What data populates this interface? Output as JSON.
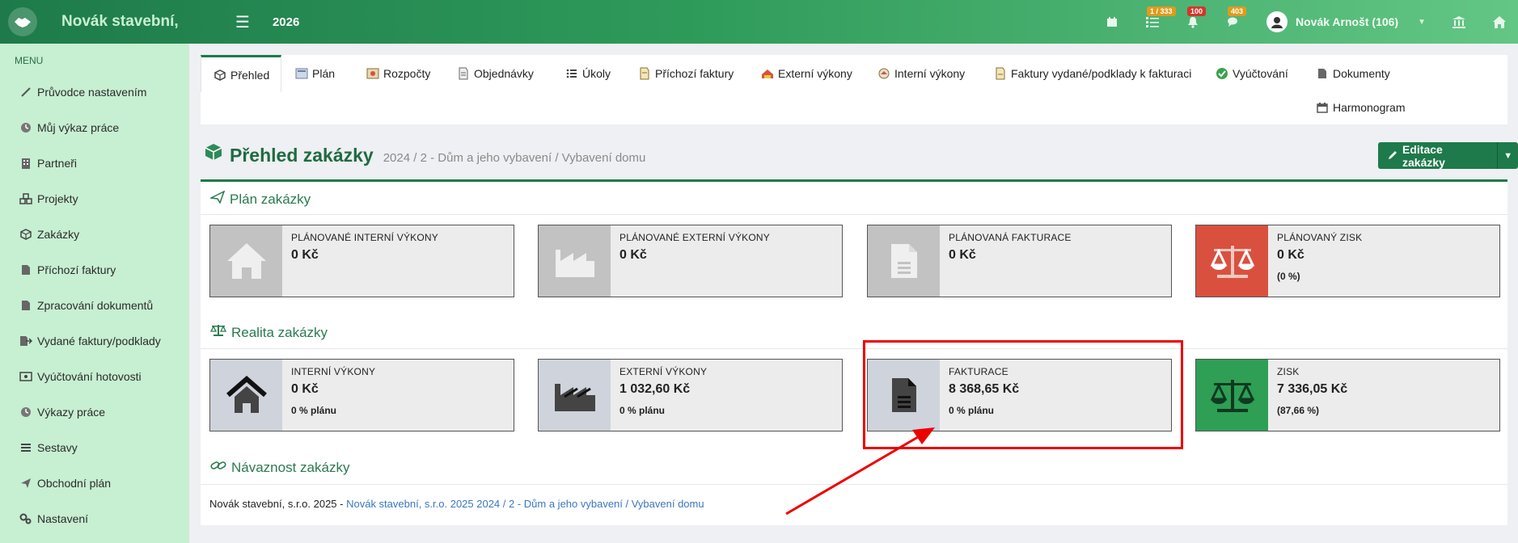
{
  "topbar": {
    "brand": "Novák stavební,",
    "year": "2026",
    "badges": {
      "tasks": "1 / 333",
      "notifications": "100",
      "messages": "403"
    },
    "user": "Novák Arnošt (106)"
  },
  "sidebar": {
    "heading": "MENU",
    "items": [
      {
        "label": "Průvodce nastavením",
        "icon": "wand-icon"
      },
      {
        "label": "Můj výkaz práce",
        "icon": "clock-icon"
      },
      {
        "label": "Partneři",
        "icon": "building-icon"
      },
      {
        "label": "Projekty",
        "icon": "cubes-icon"
      },
      {
        "label": "Zakázky",
        "icon": "cube-icon"
      },
      {
        "label": "Příchozí faktury",
        "icon": "document-icon"
      },
      {
        "label": "Zpracování dokumentů",
        "icon": "document-icon"
      },
      {
        "label": "Vydané faktury/podklady",
        "icon": "export-icon"
      },
      {
        "label": "Vyúčtování hotovosti",
        "icon": "money-icon"
      },
      {
        "label": "Výkazy práce",
        "icon": "clock-icon"
      },
      {
        "label": "Sestavy",
        "icon": "list-icon"
      },
      {
        "label": "Obchodní plán",
        "icon": "paper-plane-icon"
      },
      {
        "label": "Nastavení",
        "icon": "gears-icon"
      }
    ]
  },
  "tabs": [
    {
      "label": "Přehled"
    },
    {
      "label": "Plán"
    },
    {
      "label": "Rozpočty"
    },
    {
      "label": "Objednávky"
    },
    {
      "label": "Úkoly"
    },
    {
      "label": "Příchozí faktury"
    },
    {
      "label": "Externí výkony"
    },
    {
      "label": "Interní výkony"
    },
    {
      "label": "Faktury vydané/podklady k fakturaci"
    },
    {
      "label": "Vyúčtování"
    },
    {
      "label": "Dokumenty"
    },
    {
      "label": "Harmonogram"
    }
  ],
  "header": {
    "title": "Přehled zakázky",
    "subtitle": "2024 / 2 - Dům a jeho vybavení / Vybavení domu",
    "edit_label": "Editace zakázky"
  },
  "plan": {
    "heading": "Plán zakázky",
    "boxes": [
      {
        "label": "PLÁNOVANÉ INTERNÍ VÝKONY",
        "value": "0 Kč",
        "sub": ""
      },
      {
        "label": "PLÁNOVANÉ EXTERNÍ VÝKONY",
        "value": "0 Kč",
        "sub": ""
      },
      {
        "label": "PLÁNOVANÁ FAKTURACE",
        "value": "0 Kč",
        "sub": ""
      },
      {
        "label": "PLÁNOVANÝ ZISK",
        "value": "0 Kč",
        "sub": "(0 %)"
      }
    ]
  },
  "reality": {
    "heading": "Realita zakázky",
    "boxes": [
      {
        "label": "INTERNÍ VÝKONY",
        "value": "0 Kč",
        "sub": "0 % plánu"
      },
      {
        "label": "EXTERNÍ VÝKONY",
        "value": "1 032,60 Kč",
        "sub": "0 % plánu"
      },
      {
        "label": "FAKTURACE",
        "value": "8 368,65 Kč",
        "sub": "0 % plánu"
      },
      {
        "label": "ZISK",
        "value": "7 336,05 Kč",
        "sub": "(87,66 %)"
      }
    ]
  },
  "navaznost": {
    "heading": "Návaznost zakázky",
    "prefix": "Novák stavební, s.r.o. 2025 - ",
    "link": "Novák stavební, s.r.o. 2025 2024 / 2 - Dům a jeho vybavení / Vybavení domu"
  },
  "colors": {
    "brand_green": "#1e7a4a",
    "profit_plan_red": "#d9503f",
    "profit_green": "#2e9f55",
    "annotation_red": "#ee0000"
  }
}
